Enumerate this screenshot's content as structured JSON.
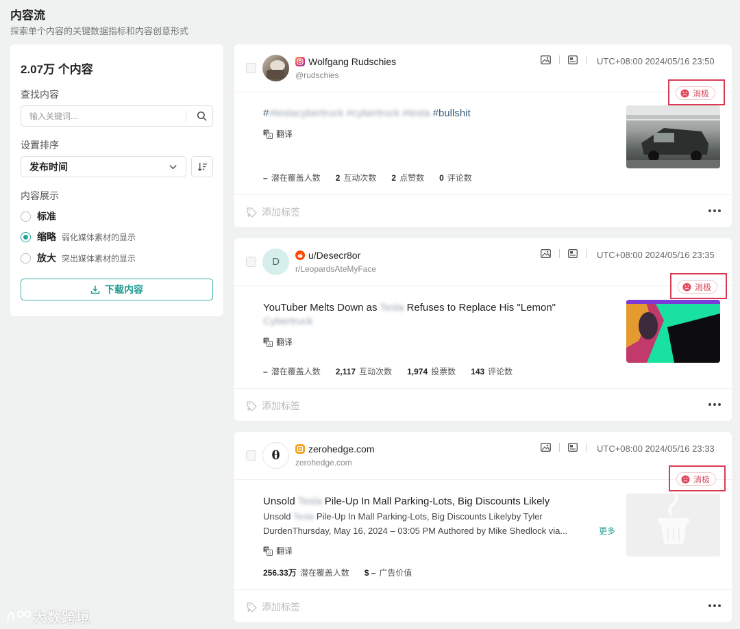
{
  "page": {
    "title": "内容流",
    "subtitle": "探索单个内容的关键数据指标和内容创意形式"
  },
  "sidebar": {
    "count": "2.07万 个内容",
    "search_label": "查找内容",
    "search_placeholder": "输入关键词...",
    "sort_label": "设置排序",
    "sort_value": "发布时间",
    "display_label": "内容展示",
    "display_options": [
      {
        "label": "标准",
        "desc": "",
        "checked": false
      },
      {
        "label": "缩略",
        "desc": "弱化媒体素材的显示",
        "checked": true
      },
      {
        "label": "放大",
        "desc": "突出媒体素材的显示",
        "checked": false
      }
    ],
    "download_label": "下载内容"
  },
  "colors": {
    "accent": "#27a39a",
    "negative": "#d8485a",
    "highlight_frame": "#d83a52"
  },
  "posts": [
    {
      "platform_icon": "instagram-icon",
      "author": "Wolfgang Rudschies",
      "handle": "@rudschies",
      "timestamp": "UTC+08:00 2024/05/16 23:50",
      "sentiment": "消极",
      "title_parts": [
        "#",
        "#teslacybertruck #cybertruck #tesla",
        " #bullshit"
      ],
      "translate": "翻译",
      "metrics": [
        {
          "value": "–",
          "label": "潜在覆盖人数"
        },
        {
          "value": "2",
          "label": "互动次数"
        },
        {
          "value": "2",
          "label": "点赞数"
        },
        {
          "value": "0",
          "label": "评论数"
        }
      ],
      "add_tag": "添加标签"
    },
    {
      "platform_icon": "reddit-icon",
      "avatar_letter": "D",
      "author": "u/Desecr8or",
      "handle": "r/LeopardsAteMyFace",
      "timestamp": "UTC+08:00 2024/05/16 23:35",
      "sentiment": "消极",
      "title_parts": [
        "YouTuber Melts Down as ",
        "Tesla",
        " Refuses to Replace His \"Lemon\""
      ],
      "title_line2": "Cybertruck",
      "translate": "翻译",
      "metrics": [
        {
          "value": "–",
          "label": "潜在覆盖人数"
        },
        {
          "value": "2,117",
          "label": "互动次数"
        },
        {
          "value": "1,974",
          "label": "投票数"
        },
        {
          "value": "143",
          "label": "评论数"
        }
      ],
      "add_tag": "添加标签"
    },
    {
      "platform_icon": "news-icon",
      "avatar_letter": "θ",
      "author": "zerohedge.com",
      "handle": "zerohedge.com",
      "timestamp": "UTC+08:00 2024/05/16 23:33",
      "sentiment": "消极",
      "title_parts": [
        "Unsold ",
        "Tesla",
        " Pile-Up In Mall Parking-Lots, Big Discounts Likely"
      ],
      "desc_line1_parts": [
        "Unsold ",
        "Tesla",
        " Pile-Up In Mall Parking-Lots, Big Discounts Likelyby Tyler"
      ],
      "desc_line2": "DurdenThursday, May 16, 2024 – 03:05 PM Authored by Mike Shedlock via...",
      "more": "更多",
      "translate": "翻译",
      "metrics": [
        {
          "value": "256.33万",
          "label": "潜在覆盖人数"
        },
        {
          "value": "$ –",
          "label": "广告价值"
        }
      ],
      "add_tag": "添加标签"
    }
  ],
  "watermark": "大数跨境"
}
